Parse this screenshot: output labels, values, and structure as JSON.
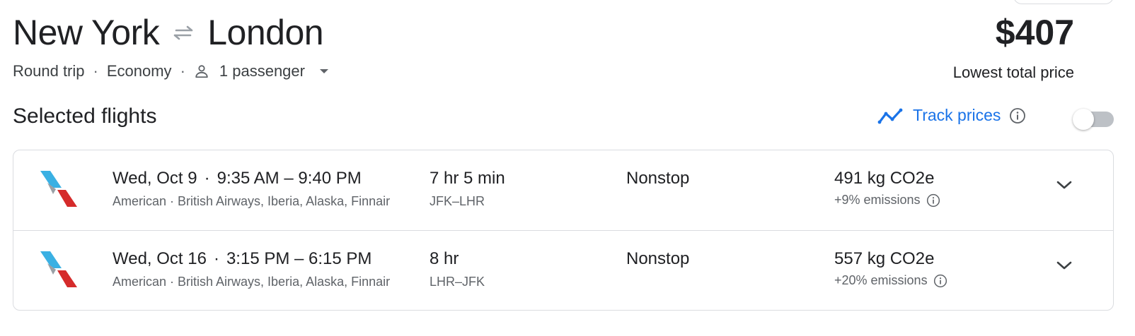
{
  "header": {
    "origin": "New York",
    "destination": "London",
    "price": "$407",
    "price_label": "Lowest total price"
  },
  "meta": {
    "trip_type": "Round trip",
    "cabin": "Economy",
    "passengers": "1 passenger"
  },
  "selected": {
    "title": "Selected flights",
    "track_label": "Track prices",
    "track_enabled": false
  },
  "flights": [
    {
      "date_label": "Wed, Oct 9",
      "time_range": "9:35 AM – 9:40 PM",
      "airlines": "American · British Airways, Iberia, Alaska, Finnair",
      "duration": "7 hr 5 min",
      "airports": "JFK–LHR",
      "stops": "Nonstop",
      "co2": "491 kg CO2e",
      "emissions": "+9% emissions"
    },
    {
      "date_label": "Wed, Oct 16",
      "time_range": "3:15 PM – 6:15 PM",
      "airlines": "American · British Airways, Iberia, Alaska, Finnair",
      "duration": "8 hr",
      "airports": "LHR–JFK",
      "stops": "Nonstop",
      "co2": "557 kg CO2e",
      "emissions": "+20% emissions"
    }
  ],
  "icons": {
    "swap": "swap-arrows-icon",
    "person": "person-icon",
    "dropdown": "caret-down-icon",
    "track": "trend-line-icon",
    "info": "info-icon",
    "expand": "chevron-down-icon",
    "airline_logo": "american-airlines-logo"
  },
  "colors": {
    "accent": "#1a73e8",
    "text_primary": "#202124",
    "text_secondary": "#5f6368",
    "logo_blue": "#3ab0e3",
    "logo_red": "#d52b2b"
  }
}
